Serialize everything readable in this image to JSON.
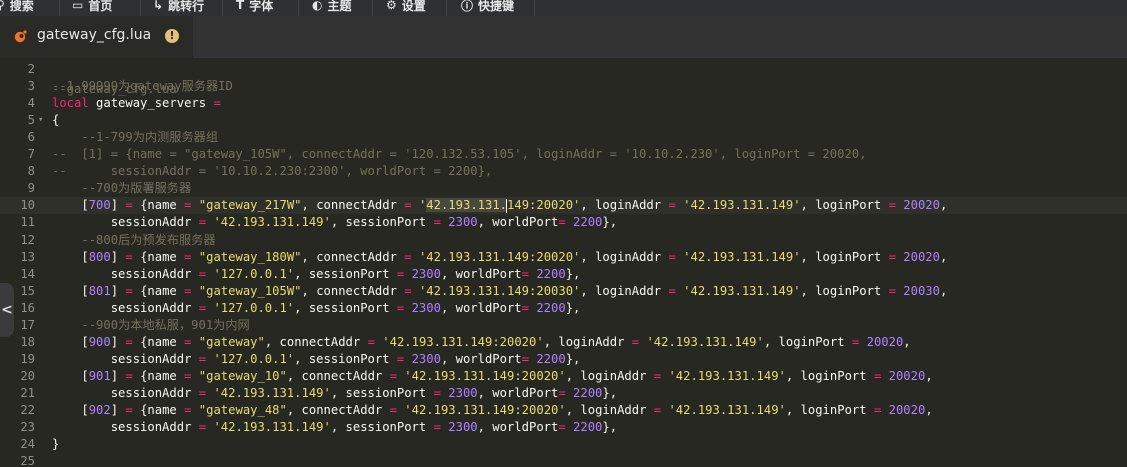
{
  "menubar": {
    "items": [
      {
        "name": "search",
        "label": "搜索",
        "icon": "search-icon"
      },
      {
        "name": "view",
        "label": "首页",
        "icon": "view-icon"
      },
      {
        "name": "run",
        "label": "跳转行",
        "icon": "run-icon"
      },
      {
        "name": "font",
        "label": "字体",
        "icon": "font-icon"
      },
      {
        "name": "theme",
        "label": "主题",
        "icon": "theme-icon"
      },
      {
        "name": "settings",
        "label": "设置",
        "icon": "gear-icon"
      },
      {
        "name": "shortcuts",
        "label": "快捷键",
        "icon": "info-icon"
      }
    ]
  },
  "tab": {
    "filename": "gateway_cfg.lua",
    "file_icon": "lua-file-icon",
    "status_icon": "warning-icon",
    "status_mark": "!"
  },
  "sidebar_handle": {
    "glyph": "<",
    "icon": "chevron-left-icon"
  },
  "colors": {
    "background": "#272822",
    "comment": "#75715e",
    "keyword": "#f92672",
    "string": "#e6db74",
    "number": "#ae81ff",
    "text": "#f8f8f2",
    "accent_warning": "#e5c07b"
  },
  "editor": {
    "first_line_fragment": "--gateway_cfg.lua",
    "current_line": 10,
    "lines": [
      {
        "n": "2",
        "fold": "",
        "tokens": []
      },
      {
        "n": "3",
        "fold": "",
        "tokens": [
          [
            "comment",
            "--1-99999为gateway服务器ID"
          ]
        ]
      },
      {
        "n": "4",
        "fold": "",
        "tokens": [
          [
            "keyword",
            "local"
          ],
          [
            "plain",
            " gateway_servers "
          ],
          [
            "op",
            "="
          ]
        ]
      },
      {
        "n": "5",
        "fold": "▾",
        "tokens": [
          [
            "plain",
            "{"
          ]
        ]
      },
      {
        "n": "6",
        "fold": "",
        "tokens": [
          [
            "plain",
            "    "
          ],
          [
            "comment",
            "--1-799为内测服务器组"
          ]
        ]
      },
      {
        "n": "7",
        "fold": "",
        "tokens": [
          [
            "comment",
            "--  [1] = {name = \"gateway_105W\", connectAddr = '120.132.53.105', loginAddr = '10.10.2.230', loginPort = 20020,"
          ]
        ]
      },
      {
        "n": "8",
        "fold": "",
        "tokens": [
          [
            "comment",
            "--      sessionAddr = '10.10.2.230:2300', worldPort = 2200},"
          ]
        ]
      },
      {
        "n": "9",
        "fold": "",
        "tokens": [
          [
            "plain",
            "    "
          ],
          [
            "comment",
            "--700为版署服务器"
          ]
        ]
      },
      {
        "n": "10",
        "fold": "",
        "tokens": [
          [
            "plain",
            "    ["
          ],
          [
            "number",
            "700"
          ],
          [
            "plain",
            "] "
          ],
          [
            "op",
            "="
          ],
          [
            "plain",
            " {name "
          ],
          [
            "op",
            "="
          ],
          [
            "plain",
            " "
          ],
          [
            "string",
            "\"gateway_217W\""
          ],
          [
            "plain",
            ", connectAddr "
          ],
          [
            "op",
            "="
          ],
          [
            "plain",
            " "
          ],
          [
            "string",
            "'"
          ],
          [
            "string-hl",
            "42.193.131."
          ],
          [
            "caret",
            ""
          ],
          [
            "string",
            "149:20020'"
          ],
          [
            "plain",
            ", loginAddr "
          ],
          [
            "op",
            "="
          ],
          [
            "plain",
            " "
          ],
          [
            "string",
            "'42.193.131.149'"
          ],
          [
            "plain",
            ", loginPort "
          ],
          [
            "op",
            "="
          ],
          [
            "plain",
            " "
          ],
          [
            "number",
            "20020"
          ],
          [
            "plain",
            ","
          ]
        ]
      },
      {
        "n": "11",
        "fold": "",
        "tokens": [
          [
            "plain",
            "        sessionAddr "
          ],
          [
            "op",
            "="
          ],
          [
            "plain",
            " "
          ],
          [
            "string",
            "'42.193.131.149'"
          ],
          [
            "plain",
            ", sessionPort "
          ],
          [
            "op",
            "="
          ],
          [
            "plain",
            " "
          ],
          [
            "number",
            "2300"
          ],
          [
            "plain",
            ", worldPort"
          ],
          [
            "op",
            "="
          ],
          [
            "plain",
            " "
          ],
          [
            "number",
            "2200"
          ],
          [
            "plain",
            "},"
          ]
        ]
      },
      {
        "n": "12",
        "fold": "",
        "tokens": [
          [
            "plain",
            "    "
          ],
          [
            "comment",
            "--800后为预发布服务器"
          ]
        ]
      },
      {
        "n": "13",
        "fold": "",
        "tokens": [
          [
            "plain",
            "    ["
          ],
          [
            "number",
            "800"
          ],
          [
            "plain",
            "] "
          ],
          [
            "op",
            "="
          ],
          [
            "plain",
            " {name "
          ],
          [
            "op",
            "="
          ],
          [
            "plain",
            " "
          ],
          [
            "string",
            "\"gateway_180W\""
          ],
          [
            "plain",
            ", connectAddr "
          ],
          [
            "op",
            "="
          ],
          [
            "plain",
            " "
          ],
          [
            "string",
            "'42.193.131.149:20020'"
          ],
          [
            "plain",
            ", loginAddr "
          ],
          [
            "op",
            "="
          ],
          [
            "plain",
            " "
          ],
          [
            "string",
            "'42.193.131.149'"
          ],
          [
            "plain",
            ", loginPort "
          ],
          [
            "op",
            "="
          ],
          [
            "plain",
            " "
          ],
          [
            "number",
            "20020"
          ],
          [
            "plain",
            ","
          ]
        ]
      },
      {
        "n": "14",
        "fold": "",
        "tokens": [
          [
            "plain",
            "        sessionAddr "
          ],
          [
            "op",
            "="
          ],
          [
            "plain",
            " "
          ],
          [
            "string",
            "'127.0.0.1'"
          ],
          [
            "plain",
            ", sessionPort "
          ],
          [
            "op",
            "="
          ],
          [
            "plain",
            " "
          ],
          [
            "number",
            "2300"
          ],
          [
            "plain",
            ", worldPort"
          ],
          [
            "op",
            "="
          ],
          [
            "plain",
            " "
          ],
          [
            "number",
            "2200"
          ],
          [
            "plain",
            "},"
          ]
        ]
      },
      {
        "n": "15",
        "fold": "",
        "tokens": [
          [
            "plain",
            "    ["
          ],
          [
            "number",
            "801"
          ],
          [
            "plain",
            "] "
          ],
          [
            "op",
            "="
          ],
          [
            "plain",
            " {name "
          ],
          [
            "op",
            "="
          ],
          [
            "plain",
            " "
          ],
          [
            "string",
            "\"gateway_105W\""
          ],
          [
            "plain",
            ", connectAddr "
          ],
          [
            "op",
            "="
          ],
          [
            "plain",
            " "
          ],
          [
            "string",
            "'42.193.131.149:20030'"
          ],
          [
            "plain",
            ", loginAddr "
          ],
          [
            "op",
            "="
          ],
          [
            "plain",
            " "
          ],
          [
            "string",
            "'42.193.131.149'"
          ],
          [
            "plain",
            ", loginPort "
          ],
          [
            "op",
            "="
          ],
          [
            "plain",
            " "
          ],
          [
            "number",
            "20030"
          ],
          [
            "plain",
            ","
          ]
        ]
      },
      {
        "n": "16",
        "fold": "",
        "tokens": [
          [
            "plain",
            "        sessionAddr "
          ],
          [
            "op",
            "="
          ],
          [
            "plain",
            " "
          ],
          [
            "string",
            "'127.0.0.1'"
          ],
          [
            "plain",
            ", sessionPort "
          ],
          [
            "op",
            "="
          ],
          [
            "plain",
            " "
          ],
          [
            "number",
            "2300"
          ],
          [
            "plain",
            ", worldPort"
          ],
          [
            "op",
            "="
          ],
          [
            "plain",
            " "
          ],
          [
            "number",
            "2200"
          ],
          [
            "plain",
            "},"
          ]
        ]
      },
      {
        "n": "17",
        "fold": "",
        "tokens": [
          [
            "plain",
            "    "
          ],
          [
            "comment",
            "--900为本地私服，901为内网"
          ]
        ]
      },
      {
        "n": "18",
        "fold": "",
        "tokens": [
          [
            "plain",
            "    ["
          ],
          [
            "number",
            "900"
          ],
          [
            "plain",
            "] "
          ],
          [
            "op",
            "="
          ],
          [
            "plain",
            " {name "
          ],
          [
            "op",
            "="
          ],
          [
            "plain",
            " "
          ],
          [
            "string",
            "\"gateway\""
          ],
          [
            "plain",
            ", connectAddr "
          ],
          [
            "op",
            "="
          ],
          [
            "plain",
            " "
          ],
          [
            "string",
            "'42.193.131.149:20020'"
          ],
          [
            "plain",
            ", loginAddr "
          ],
          [
            "op",
            "="
          ],
          [
            "plain",
            " "
          ],
          [
            "string",
            "'42.193.131.149'"
          ],
          [
            "plain",
            ", loginPort "
          ],
          [
            "op",
            "="
          ],
          [
            "plain",
            " "
          ],
          [
            "number",
            "20020"
          ],
          [
            "plain",
            ","
          ]
        ]
      },
      {
        "n": "19",
        "fold": "",
        "tokens": [
          [
            "plain",
            "        sessionAddr "
          ],
          [
            "op",
            "="
          ],
          [
            "plain",
            " "
          ],
          [
            "string",
            "'127.0.0.1'"
          ],
          [
            "plain",
            ", sessionPort "
          ],
          [
            "op",
            "="
          ],
          [
            "plain",
            " "
          ],
          [
            "number",
            "2300"
          ],
          [
            "plain",
            ", worldPort"
          ],
          [
            "op",
            "="
          ],
          [
            "plain",
            " "
          ],
          [
            "number",
            "2200"
          ],
          [
            "plain",
            "},"
          ]
        ]
      },
      {
        "n": "20",
        "fold": "",
        "tokens": [
          [
            "plain",
            "    ["
          ],
          [
            "number",
            "901"
          ],
          [
            "plain",
            "] "
          ],
          [
            "op",
            "="
          ],
          [
            "plain",
            " {name "
          ],
          [
            "op",
            "="
          ],
          [
            "plain",
            " "
          ],
          [
            "string",
            "\"gateway_10\""
          ],
          [
            "plain",
            ", connectAddr "
          ],
          [
            "op",
            "="
          ],
          [
            "plain",
            " "
          ],
          [
            "string",
            "'42.193.131.149:20020'"
          ],
          [
            "plain",
            ", loginAddr "
          ],
          [
            "op",
            "="
          ],
          [
            "plain",
            " "
          ],
          [
            "string",
            "'42.193.131.149'"
          ],
          [
            "plain",
            ", loginPort "
          ],
          [
            "op",
            "="
          ],
          [
            "plain",
            " "
          ],
          [
            "number",
            "20020"
          ],
          [
            "plain",
            ","
          ]
        ]
      },
      {
        "n": "21",
        "fold": "",
        "tokens": [
          [
            "plain",
            "        sessionAddr "
          ],
          [
            "op",
            "="
          ],
          [
            "plain",
            " "
          ],
          [
            "string",
            "'42.193.131.149'"
          ],
          [
            "plain",
            ", sessionPort "
          ],
          [
            "op",
            "="
          ],
          [
            "plain",
            " "
          ],
          [
            "number",
            "2300"
          ],
          [
            "plain",
            ", worldPort"
          ],
          [
            "op",
            "="
          ],
          [
            "plain",
            " "
          ],
          [
            "number",
            "2200"
          ],
          [
            "plain",
            "},"
          ]
        ]
      },
      {
        "n": "22",
        "fold": "",
        "tokens": [
          [
            "plain",
            "    ["
          ],
          [
            "number",
            "902"
          ],
          [
            "plain",
            "] "
          ],
          [
            "op",
            "="
          ],
          [
            "plain",
            " {name "
          ],
          [
            "op",
            "="
          ],
          [
            "plain",
            " "
          ],
          [
            "string",
            "\"gateway_48\""
          ],
          [
            "plain",
            ", connectAddr "
          ],
          [
            "op",
            "="
          ],
          [
            "plain",
            " "
          ],
          [
            "string",
            "'42.193.131.149:20020'"
          ],
          [
            "plain",
            ", loginAddr "
          ],
          [
            "op",
            "="
          ],
          [
            "plain",
            " "
          ],
          [
            "string",
            "'42.193.131.149'"
          ],
          [
            "plain",
            ", loginPort "
          ],
          [
            "op",
            "="
          ],
          [
            "plain",
            " "
          ],
          [
            "number",
            "20020"
          ],
          [
            "plain",
            ","
          ]
        ]
      },
      {
        "n": "23",
        "fold": "",
        "tokens": [
          [
            "plain",
            "        sessionAddr "
          ],
          [
            "op",
            "="
          ],
          [
            "plain",
            " "
          ],
          [
            "string",
            "'42.193.131.149'"
          ],
          [
            "plain",
            ", sessionPort "
          ],
          [
            "op",
            "="
          ],
          [
            "plain",
            " "
          ],
          [
            "number",
            "2300"
          ],
          [
            "plain",
            ", worldPort"
          ],
          [
            "op",
            "="
          ],
          [
            "plain",
            " "
          ],
          [
            "number",
            "2200"
          ],
          [
            "plain",
            "},"
          ]
        ]
      },
      {
        "n": "24",
        "fold": "",
        "tokens": [
          [
            "plain",
            "}"
          ]
        ]
      },
      {
        "n": "25",
        "fold": "",
        "tokens": []
      }
    ]
  }
}
